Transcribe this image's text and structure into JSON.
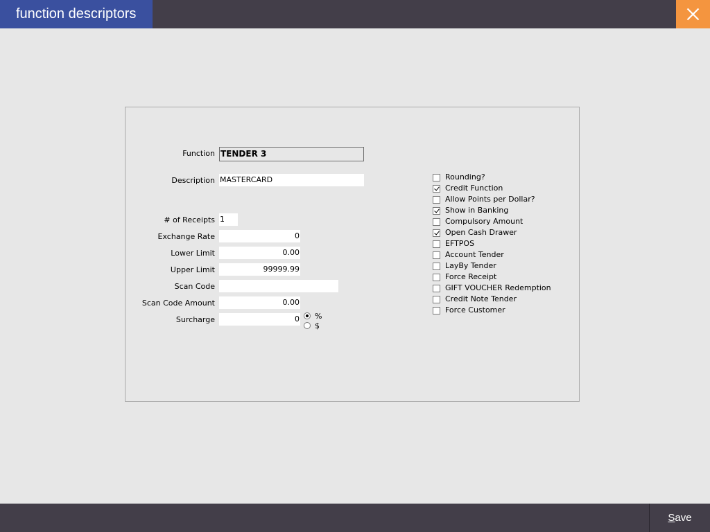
{
  "window": {
    "title": "function descriptors",
    "close_icon": "close-icon"
  },
  "form": {
    "function_label": "Function",
    "function_value": "TENDER 3",
    "description_label": "Description",
    "description_value": "MASTERCARD",
    "receipts_label": "# of Receipts",
    "receipts_value": "1",
    "exchange_rate_label": "Exchange Rate",
    "exchange_rate_value": "0",
    "lower_limit_label": "Lower Limit",
    "lower_limit_value": "0.00",
    "upper_limit_label": "Upper Limit",
    "upper_limit_value": "99999.99",
    "scan_code_label": "Scan Code",
    "scan_code_value": "",
    "scan_code_amount_label": "Scan Code Amount",
    "scan_code_amount_value": "0.00",
    "surcharge_label": "Surcharge",
    "surcharge_value": "0",
    "surcharge_type_options": [
      {
        "label": "%",
        "selected": true
      },
      {
        "label": "$",
        "selected": false
      }
    ]
  },
  "options": [
    {
      "label": "Rounding?",
      "checked": false
    },
    {
      "label": "Credit Function",
      "checked": true
    },
    {
      "label": "Allow Points per Dollar?",
      "checked": false
    },
    {
      "label": "Show in Banking",
      "checked": true
    },
    {
      "label": "Compulsory Amount",
      "checked": false
    },
    {
      "label": "Open Cash Drawer",
      "checked": true
    },
    {
      "label": "EFTPOS",
      "checked": false
    },
    {
      "label": "Account Tender",
      "checked": false
    },
    {
      "label": "LayBy Tender",
      "checked": false
    },
    {
      "label": "Force Receipt",
      "checked": false
    },
    {
      "label": "GIFT VOUCHER Redemption",
      "checked": false
    },
    {
      "label": "Credit Note Tender",
      "checked": false
    },
    {
      "label": "Force Customer",
      "checked": false
    }
  ],
  "footer": {
    "save_label_mnemonic": "S",
    "save_label_rest": "ave"
  },
  "colors": {
    "titlebar": "#433e49",
    "title_tab": "#3a509f",
    "close_button": "#f4953f",
    "background": "#e7e7e7"
  }
}
